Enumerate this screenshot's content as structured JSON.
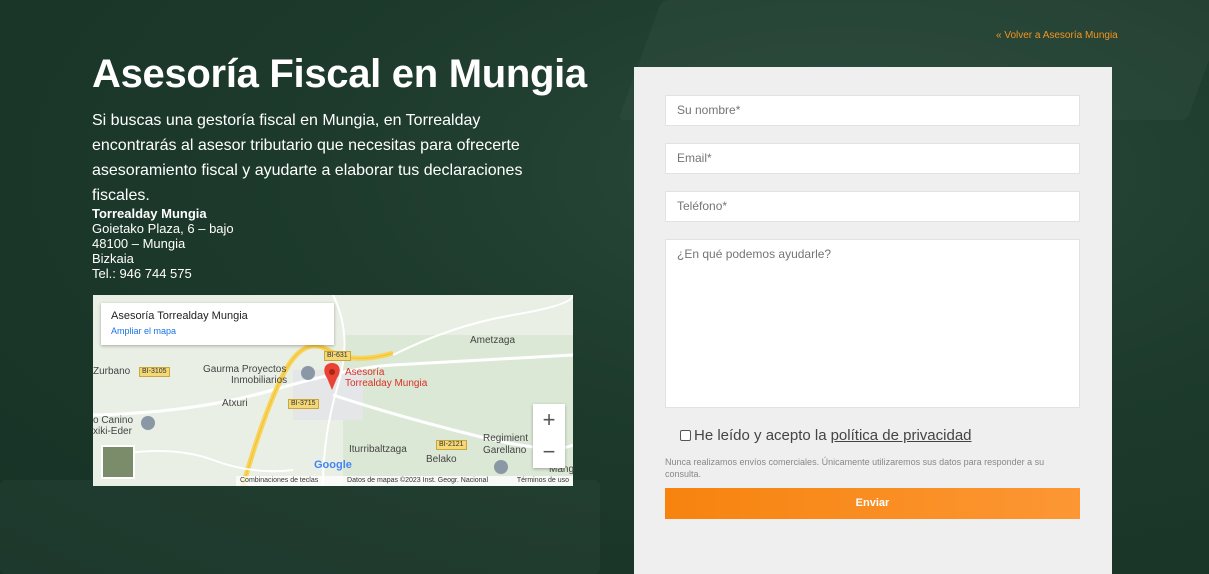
{
  "header": {
    "back_link": "« Volver a Asesoría Mungia"
  },
  "hero": {
    "title": "Asesoría Fiscal en Mungia",
    "description": "Si buscas una gestoría fiscal en Mungia, en Torrealday encontrarás al asesor tributario que necesitas para ofrecerte asesoramiento fiscal y ayudarte a elaborar tus declaraciones fiscales."
  },
  "address": {
    "name": "Torrealday Mungia",
    "street": "Goietako Plaza, 6 – bajo",
    "city": "48100 – Mungia",
    "region": "Bizkaia",
    "phone": "Tel.: 946 744 575"
  },
  "map": {
    "card_title": "Asesoría Torrealday Mungia",
    "card_link": "Ampliar el mapa",
    "places": {
      "ametzaga": "Ametzaga",
      "zurbano": "Zurbano",
      "gaurma_1": "Gaurma Proyectos",
      "gaurma_2": "Inmobiliarios",
      "marker_1": "Asesoría",
      "marker_2": "Torrealday Mungia",
      "atxuri": "Atxuri",
      "canino_1": "o Canino",
      "canino_2": "xiki-Eder",
      "iturribaltzaga": "Iturribaltzaga",
      "belako": "Belako",
      "regimiento_1": "Regimient",
      "regimiento_2": "Garellano",
      "mang": "Mang"
    },
    "roads": {
      "bi631": "BI-631",
      "bi3105": "BI-3105",
      "bi3715": "BI-3715",
      "bi2121": "BI-2121"
    },
    "zoom_in": "+",
    "zoom_out": "−",
    "google": "Google",
    "footer_shortcuts": "Combinaciones de teclas",
    "footer_data": "Datos de mapas ©2023 Inst. Geogr. Nacional",
    "footer_terms": "Términos de uso"
  },
  "form": {
    "name_placeholder": "Su nombre*",
    "email_placeholder": "Email*",
    "phone_placeholder": "Teléfono*",
    "message_placeholder": "¿En qué podemos ayudarle?",
    "consent_text": "He leído y acepto la",
    "consent_link": "política de privacidad",
    "note": "Nunca realizamos envíos comerciales. Únicamente utilizaremos sus datos para responder a su consulta.",
    "submit": "Enviar"
  },
  "colors": {
    "accent": "#f7931e",
    "background": "#1d3a2c",
    "panel": "#efefef"
  }
}
